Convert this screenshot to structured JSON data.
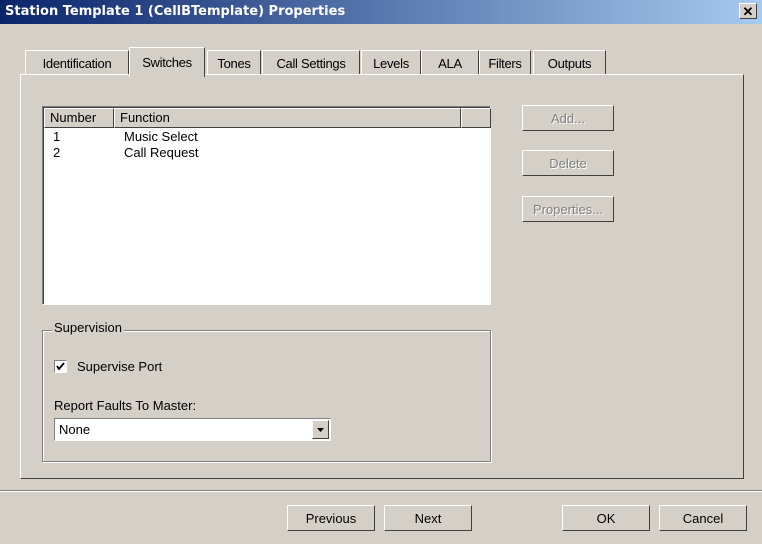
{
  "window": {
    "title": "Station Template 1 (CellBTemplate) Properties",
    "close_label": "✕"
  },
  "tabs": [
    {
      "label": "Identification",
      "active": false
    },
    {
      "label": "Switches",
      "active": true
    },
    {
      "label": "Tones",
      "active": false
    },
    {
      "label": "Call Settings",
      "active": false
    },
    {
      "label": "Levels",
      "active": false
    },
    {
      "label": "ALA",
      "active": false
    },
    {
      "label": "Filters",
      "active": false
    },
    {
      "label": "Outputs",
      "active": false
    }
  ],
  "switches_list": {
    "columns": [
      "Number",
      "Function"
    ],
    "rows": [
      {
        "number": "1",
        "function": "Music Select"
      },
      {
        "number": "2",
        "function": "Call Request"
      }
    ]
  },
  "side_buttons": {
    "add": "Add...",
    "delete": "Delete",
    "properties": "Properties..."
  },
  "supervision": {
    "label": "Supervision",
    "supervise_port_label": "Supervise Port",
    "supervise_port_checked": true,
    "report_faults_label": "Report Faults To Master:",
    "report_faults_value": "None"
  },
  "footer": {
    "previous": "Previous",
    "next": "Next",
    "ok": "OK",
    "cancel": "Cancel"
  }
}
